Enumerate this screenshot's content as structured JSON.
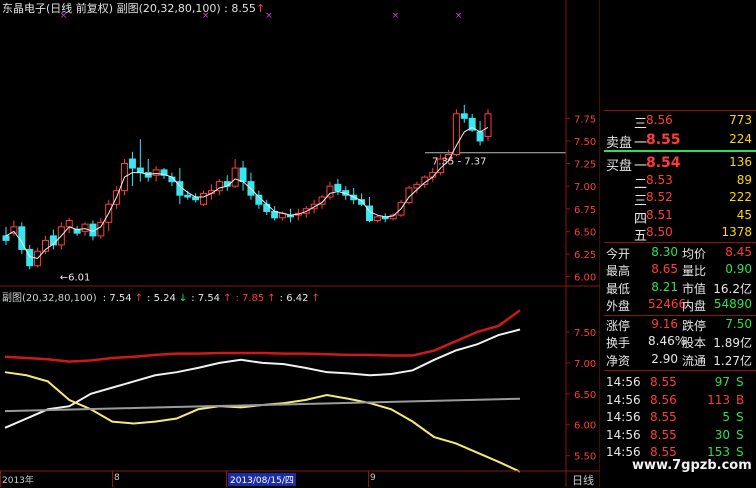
{
  "main_title": "东晶电子(日线 前复权) 副图(20,32,80,100) : 8.55",
  "main_title_arrow": "↑",
  "sub_title": {
    "prefix": "副图(20,32,80,100)",
    "values": [
      {
        "text": ": 7.54",
        "arrow": "↑",
        "color": "#e6e6e6"
      },
      {
        "text": ": 5.24",
        "arrow": "↓",
        "color": "#e6e6e6"
      },
      {
        "text": ": 7.54",
        "arrow": "↑",
        "color": "#e6e6e6"
      },
      {
        "text": ": 7.85",
        "arrow": "↑",
        "color": "#ff3c3c"
      },
      {
        "text": ": 6.42",
        "arrow": "↑",
        "color": "#e6e6e6"
      }
    ]
  },
  "annotations": {
    "low_label": "←6.01",
    "range_label": "7.35 - 7.37"
  },
  "bottom_axis": {
    "labels": [
      "2013年",
      "8",
      "2013/08/15/四",
      "9"
    ],
    "period": "日线"
  },
  "watermark": "www.7gpzb.com",
  "colors": {
    "up": "#ff3c3c",
    "down": "#39e6ef",
    "grid": "#8a1414",
    "red_line": "#d01818",
    "white_line": "#f0f0f0",
    "yellow_line": "#f5e97a",
    "gray_line": "#9a9a9a"
  },
  "chart_data": [
    {
      "type": "candlestick",
      "yaxis_ticks": [
        "7.75",
        "7.50",
        "7.25",
        "7.00",
        "6.75",
        "6.50",
        "6.25",
        "6.00"
      ],
      "ylim": [
        5.94,
        7.82
      ],
      "reference_price": 7.37,
      "ohlc": [
        [
          6.45,
          6.55,
          6.35,
          6.4
        ],
        [
          6.48,
          6.62,
          6.45,
          6.55
        ],
        [
          6.55,
          6.6,
          6.25,
          6.3
        ],
        [
          6.3,
          6.35,
          6.08,
          6.12
        ],
        [
          6.12,
          6.32,
          6.1,
          6.28
        ],
        [
          6.28,
          6.45,
          6.25,
          6.4
        ],
        [
          6.45,
          6.52,
          6.3,
          6.35
        ],
        [
          6.35,
          6.6,
          6.3,
          6.55
        ],
        [
          6.55,
          6.65,
          6.48,
          6.62
        ],
        [
          6.52,
          6.56,
          6.45,
          6.48
        ],
        [
          6.5,
          6.6,
          6.45,
          6.58
        ],
        [
          6.58,
          6.62,
          6.4,
          6.45
        ],
        [
          6.45,
          6.65,
          6.42,
          6.6
        ],
        [
          6.6,
          6.85,
          6.5,
          6.8
        ],
        [
          6.8,
          7.0,
          6.75,
          6.95
        ],
        [
          6.95,
          7.3,
          6.9,
          7.25
        ],
        [
          7.3,
          7.38,
          7.0,
          7.2
        ],
        [
          7.2,
          7.52,
          7.05,
          7.15
        ],
        [
          7.15,
          7.3,
          7.05,
          7.1
        ],
        [
          7.12,
          7.22,
          7.05,
          7.18
        ],
        [
          7.18,
          7.2,
          7.08,
          7.12
        ],
        [
          7.1,
          7.15,
          7.0,
          7.05
        ],
        [
          7.05,
          7.2,
          6.8,
          6.9
        ],
        [
          6.9,
          6.95,
          6.85,
          6.88
        ],
        [
          6.88,
          6.92,
          6.82,
          6.85
        ],
        [
          6.8,
          6.95,
          6.78,
          6.92
        ],
        [
          6.92,
          7.02,
          6.85,
          6.95
        ],
        [
          6.95,
          7.08,
          6.9,
          7.05
        ],
        [
          7.05,
          7.12,
          6.95,
          7.0
        ],
        [
          7.0,
          7.3,
          6.98,
          7.2
        ],
        [
          7.2,
          7.28,
          6.95,
          7.05
        ],
        [
          7.05,
          7.15,
          6.85,
          6.9
        ],
        [
          6.9,
          6.95,
          6.75,
          6.8
        ],
        [
          6.8,
          6.85,
          6.68,
          6.72
        ],
        [
          6.72,
          6.78,
          6.62,
          6.65
        ],
        [
          6.65,
          6.72,
          6.62,
          6.7
        ],
        [
          6.68,
          6.75,
          6.6,
          6.66
        ],
        [
          6.68,
          6.75,
          6.62,
          6.7
        ],
        [
          6.7,
          6.78,
          6.65,
          6.75
        ],
        [
          6.75,
          6.85,
          6.7,
          6.8
        ],
        [
          6.8,
          6.9,
          6.75,
          6.88
        ],
        [
          6.88,
          7.05,
          6.85,
          7.0
        ],
        [
          7.02,
          7.08,
          6.9,
          6.95
        ],
        [
          6.95,
          7.0,
          6.85,
          6.9
        ],
        [
          6.9,
          6.98,
          6.8,
          6.85
        ],
        [
          6.85,
          6.92,
          6.78,
          6.8
        ],
        [
          6.78,
          6.88,
          6.6,
          6.62
        ],
        [
          6.62,
          6.68,
          6.6,
          6.66
        ],
        [
          6.66,
          6.7,
          6.6,
          6.64
        ],
        [
          6.64,
          6.7,
          6.62,
          6.68
        ],
        [
          6.68,
          6.85,
          6.66,
          6.82
        ],
        [
          6.82,
          7.0,
          6.8,
          6.98
        ],
        [
          6.98,
          7.05,
          6.92,
          7.02
        ],
        [
          7.02,
          7.12,
          6.98,
          7.1
        ],
        [
          7.1,
          7.2,
          7.05,
          7.15
        ],
        [
          7.15,
          7.35,
          7.12,
          7.3
        ],
        [
          7.3,
          7.4,
          7.25,
          7.35
        ],
        [
          7.35,
          7.85,
          7.33,
          7.8
        ],
        [
          7.8,
          7.9,
          7.7,
          7.75
        ],
        [
          7.75,
          7.8,
          7.6,
          7.62
        ],
        [
          7.6,
          7.72,
          7.45,
          7.5
        ],
        [
          7.55,
          7.85,
          7.5,
          7.8
        ]
      ],
      "ma_line": [
        6.45,
        6.5,
        6.38,
        6.22,
        6.2,
        6.3,
        6.36,
        6.45,
        6.55,
        6.52,
        6.53,
        6.5,
        6.55,
        6.7,
        6.88,
        7.1,
        7.15,
        7.15,
        7.13,
        7.14,
        7.13,
        7.1,
        7.0,
        6.93,
        6.88,
        6.88,
        6.92,
        6.98,
        7.0,
        7.08,
        7.05,
        6.97,
        6.88,
        6.8,
        6.72,
        6.7,
        6.68,
        6.69,
        6.72,
        6.77,
        6.82,
        6.92,
        6.94,
        6.92,
        6.88,
        6.84,
        6.72,
        6.68,
        6.66,
        6.67,
        6.75,
        6.88,
        6.96,
        7.04,
        7.1,
        7.2,
        7.28,
        7.45,
        7.6,
        7.65,
        7.6,
        7.65
      ],
      "signal_marker_indices": [
        3,
        21,
        29,
        45,
        53
      ]
    },
    {
      "type": "line",
      "yaxis_ticks": [
        "7.50",
        "7.00",
        "6.50",
        "6.00",
        "5.50"
      ],
      "ylim": [
        5.3,
        8.05
      ],
      "series": [
        {
          "color": "#d01818",
          "values": [
            7.1,
            7.08,
            7.06,
            7.02,
            7.04,
            7.08,
            7.1,
            7.13,
            7.15,
            7.15,
            7.16,
            7.16,
            7.16,
            7.15,
            7.15,
            7.14,
            7.13,
            7.13,
            7.12,
            7.12,
            7.2,
            7.35,
            7.5,
            7.6,
            7.85
          ]
        },
        {
          "color": "#f0f0f0",
          "values": [
            5.95,
            6.1,
            6.25,
            6.3,
            6.5,
            6.6,
            6.7,
            6.8,
            6.85,
            6.92,
            7.0,
            7.05,
            7.0,
            6.98,
            6.92,
            6.85,
            6.83,
            6.8,
            6.82,
            6.88,
            7.05,
            7.2,
            7.3,
            7.45,
            7.54
          ]
        },
        {
          "color": "#f5e97a",
          "values": [
            6.85,
            6.8,
            6.7,
            6.4,
            6.25,
            6.05,
            6.02,
            6.05,
            6.1,
            6.25,
            6.3,
            6.28,
            6.32,
            6.35,
            6.4,
            6.48,
            6.42,
            6.35,
            6.25,
            6.05,
            5.8,
            5.7,
            5.55,
            5.4,
            5.24
          ]
        },
        {
          "color": "#9a9a9a",
          "values": [
            6.22,
            6.23,
            6.24,
            6.25,
            6.26,
            6.27,
            6.28,
            6.29,
            6.3,
            6.31,
            6.32,
            6.33,
            6.34,
            6.35,
            6.36,
            6.37,
            6.38,
            6.39,
            6.4,
            6.41,
            6.42
          ]
        }
      ]
    }
  ],
  "panel": {
    "sell_label": "卖盘",
    "buy_label": "买盘",
    "sell_rows": [
      {
        "level": "三",
        "price": "8.56",
        "volume": "773"
      },
      {
        "level": "一",
        "price": "8.55",
        "volume": "224"
      }
    ],
    "buy_rows": [
      {
        "level": "一",
        "price": "8.54",
        "volume": "136"
      },
      {
        "level": "二",
        "price": "8.53",
        "volume": "89"
      },
      {
        "level": "三",
        "price": "8.52",
        "volume": "222"
      },
      {
        "level": "四",
        "price": "8.51",
        "volume": "45"
      },
      {
        "level": "五",
        "price": "8.50",
        "volume": "1378"
      }
    ],
    "stats": [
      [
        {
          "label": "今开",
          "value": "8.30",
          "cls": "grn"
        },
        {
          "label": "均价",
          "value": "8.45",
          "cls": "red"
        }
      ],
      [
        {
          "label": "最高",
          "value": "8.65",
          "cls": "red"
        },
        {
          "label": "量比",
          "value": "0.90",
          "cls": "grn"
        }
      ],
      [
        {
          "label": "最低",
          "value": "8.21",
          "cls": "grn"
        },
        {
          "label": "市值",
          "value": "16.2亿",
          "cls": "wht"
        }
      ],
      [
        {
          "label": "外盘",
          "value": "52466",
          "cls": "red"
        },
        {
          "label": "内盘",
          "value": "54890",
          "cls": "grn"
        }
      ],
      [
        {
          "label": "涨停",
          "value": "9.16",
          "cls": "red"
        },
        {
          "label": "跌停",
          "value": "7.50",
          "cls": "grn"
        }
      ],
      [
        {
          "label": "换手",
          "value": "8.46%",
          "cls": "wht"
        },
        {
          "label": "股本",
          "value": "1.89亿",
          "cls": "wht"
        }
      ],
      [
        {
          "label": "净资",
          "value": "2.90",
          "cls": "wht"
        },
        {
          "label": "流通",
          "value": "1.27亿",
          "cls": "wht"
        }
      ]
    ],
    "ticks": [
      {
        "time": "14:56",
        "price": "8.55",
        "volume": "97",
        "side": "S"
      },
      {
        "time": "14:56",
        "price": "8.56",
        "volume": "113",
        "side": "B"
      },
      {
        "time": "14:56",
        "price": "8.55",
        "volume": "5",
        "side": "S"
      },
      {
        "time": "14:56",
        "price": "8.55",
        "volume": "30",
        "side": "S"
      },
      {
        "time": "14:56",
        "price": "8.55",
        "volume": "153",
        "side": "S"
      }
    ]
  }
}
